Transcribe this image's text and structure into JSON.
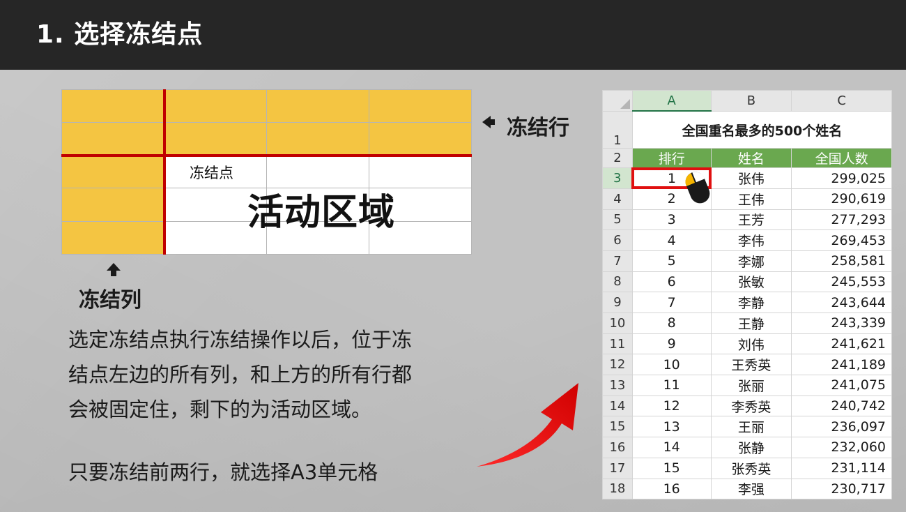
{
  "slide": {
    "title": "1. 选择冻结点"
  },
  "illustration": {
    "freeze_point_label": "冻结点",
    "active_area_label": "活动区域",
    "freeze_row_label": "冻结行",
    "freeze_col_label": "冻结列",
    "colors": {
      "frozen": "#f4c542",
      "freeze_line": "#c00000"
    }
  },
  "description": {
    "lines": [
      "选定冻结点执行冻结操作以后，位于冻",
      "结点左边的所有列，和上方的所有行都",
      "会被固定住，剩下的为活动区域。"
    ],
    "tip": "只要冻结前两行，就选择A3单元格"
  },
  "sheet": {
    "columns": [
      "A",
      "B",
      "C"
    ],
    "title_row_number": "1",
    "title": "全国重名最多的500个姓名",
    "header_row_number": "2",
    "headers": [
      "排行",
      "姓名",
      "全国人数"
    ],
    "header_color": "#6aa84f",
    "selected_cell": "A3",
    "rows": [
      {
        "num": "3",
        "rank": "1",
        "name": "张伟",
        "count": "299,025"
      },
      {
        "num": "4",
        "rank": "2",
        "name": "王伟",
        "count": "290,619"
      },
      {
        "num": "5",
        "rank": "3",
        "name": "王芳",
        "count": "277,293"
      },
      {
        "num": "6",
        "rank": "4",
        "name": "李伟",
        "count": "269,453"
      },
      {
        "num": "7",
        "rank": "5",
        "name": "李娜",
        "count": "258,581"
      },
      {
        "num": "8",
        "rank": "6",
        "name": "张敏",
        "count": "245,553"
      },
      {
        "num": "9",
        "rank": "7",
        "name": "李静",
        "count": "243,644"
      },
      {
        "num": "10",
        "rank": "8",
        "name": "王静",
        "count": "243,339"
      },
      {
        "num": "11",
        "rank": "9",
        "name": "刘伟",
        "count": "241,621"
      },
      {
        "num": "12",
        "rank": "10",
        "name": "王秀英",
        "count": "241,189"
      },
      {
        "num": "13",
        "rank": "11",
        "name": "张丽",
        "count": "241,075"
      },
      {
        "num": "14",
        "rank": "12",
        "name": "李秀英",
        "count": "240,742"
      },
      {
        "num": "15",
        "rank": "13",
        "name": "王丽",
        "count": "236,097"
      },
      {
        "num": "16",
        "rank": "14",
        "name": "张静",
        "count": "232,060"
      },
      {
        "num": "17",
        "rank": "15",
        "name": "张秀英",
        "count": "231,114"
      },
      {
        "num": "18",
        "rank": "16",
        "name": "李强",
        "count": "230,717"
      }
    ]
  }
}
